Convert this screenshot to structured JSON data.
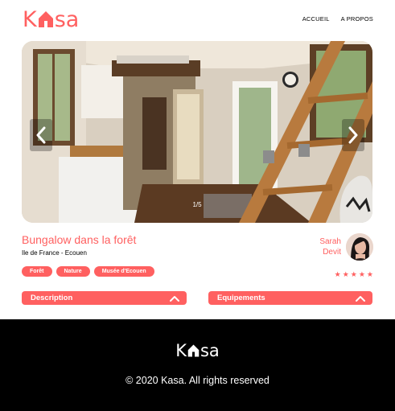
{
  "header": {
    "logo_prefix": "K",
    "logo_suffix": "sa",
    "nav": [
      {
        "label": "ACCUEIL"
      },
      {
        "label": "A PROPOS"
      }
    ]
  },
  "gallery": {
    "counter": "1/5",
    "current_index": 1,
    "total_images": 5
  },
  "listing": {
    "title": "Bungalow dans la forêt",
    "location": "Ile de France - Ecouen",
    "tags": [
      "Forêt",
      "Nature",
      "Musée d'Ecouen"
    ],
    "host": {
      "first_name": "Sarah",
      "last_name": "Devit"
    },
    "rating": 5,
    "rating_max": 5
  },
  "collapses": {
    "description_label": "Description",
    "equipment_label": "Equipements"
  },
  "footer": {
    "logo_prefix": "K",
    "logo_suffix": "sa",
    "copyright": "© 2020 Kasa. All rights reserved"
  },
  "colors": {
    "brand": "#ff6060",
    "footer_bg": "#000000"
  }
}
